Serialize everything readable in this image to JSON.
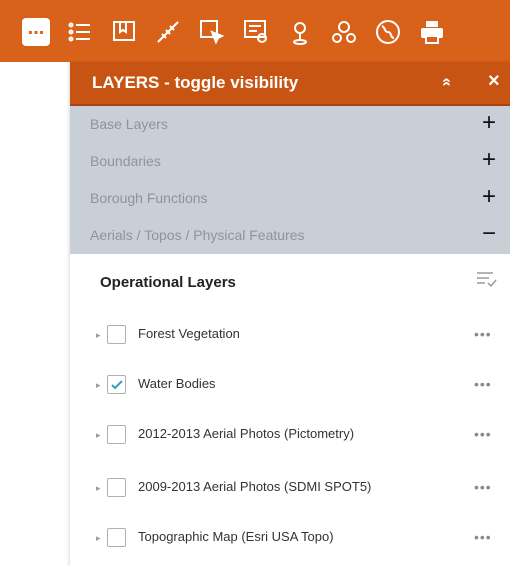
{
  "toolbar": {
    "items": [
      {
        "icon": "layers-folder-icon",
        "active": true
      },
      {
        "icon": "legend-list-icon"
      },
      {
        "icon": "bookmark-map-icon"
      },
      {
        "icon": "measure-icon"
      },
      {
        "icon": "select-icon"
      },
      {
        "icon": "query-icon"
      },
      {
        "icon": "location-pin-icon"
      },
      {
        "icon": "nearby-icon"
      },
      {
        "icon": "globe-icon"
      },
      {
        "icon": "print-icon"
      }
    ],
    "active_glyph": "...",
    "accent_color": "#d9621a"
  },
  "panel": {
    "title": "LAYERS - toggle visibility",
    "collapse_glyph": "»",
    "close_glyph": "×",
    "header_color": "#c85413"
  },
  "groups": [
    {
      "label": "Base Layers",
      "toggle": "+"
    },
    {
      "label": "Boundaries",
      "toggle": "+"
    },
    {
      "label": "Borough Functions",
      "toggle": "+"
    },
    {
      "label": "Aerials / Topos / Physical Features",
      "toggle": "−"
    }
  ],
  "operational": {
    "title": "Operational Layers",
    "layers": [
      {
        "label": "Forest Vegetation",
        "checked": false
      },
      {
        "label": "Water Bodies",
        "checked": true
      },
      {
        "label": "2012-2013 Aerial Photos (Pictometry)",
        "checked": false
      },
      {
        "label": "2009-2013 Aerial Photos (SDMI SPOT5)",
        "checked": false
      },
      {
        "label": "Topographic Map (Esri USA Topo)",
        "checked": false
      }
    ],
    "more_glyph": "•••",
    "caret_glyph": "▸"
  }
}
